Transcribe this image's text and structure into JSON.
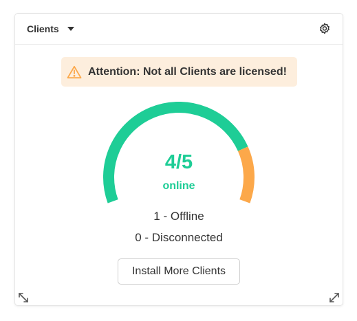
{
  "widget": {
    "title": "Clients",
    "title_dropdown_icon": "caret-down-icon",
    "settings_icon": "gear-icon"
  },
  "alert": {
    "icon": "warning-icon",
    "text": "Attention: Not all Clients are licensed!"
  },
  "gauge": {
    "online": 4,
    "total": 5,
    "count_text": "4/5",
    "status_label": "online",
    "colors": {
      "online": "#1ecd96",
      "offline": "#fca84a"
    }
  },
  "stats": {
    "offline_text": "1 - Offline",
    "disconnected_text": "0 - Disconnected"
  },
  "actions": {
    "install_label": "Install More Clients"
  },
  "footer": {
    "resize_left_icon": "shrink-arrows-icon",
    "resize_right_icon": "expand-arrows-icon"
  }
}
